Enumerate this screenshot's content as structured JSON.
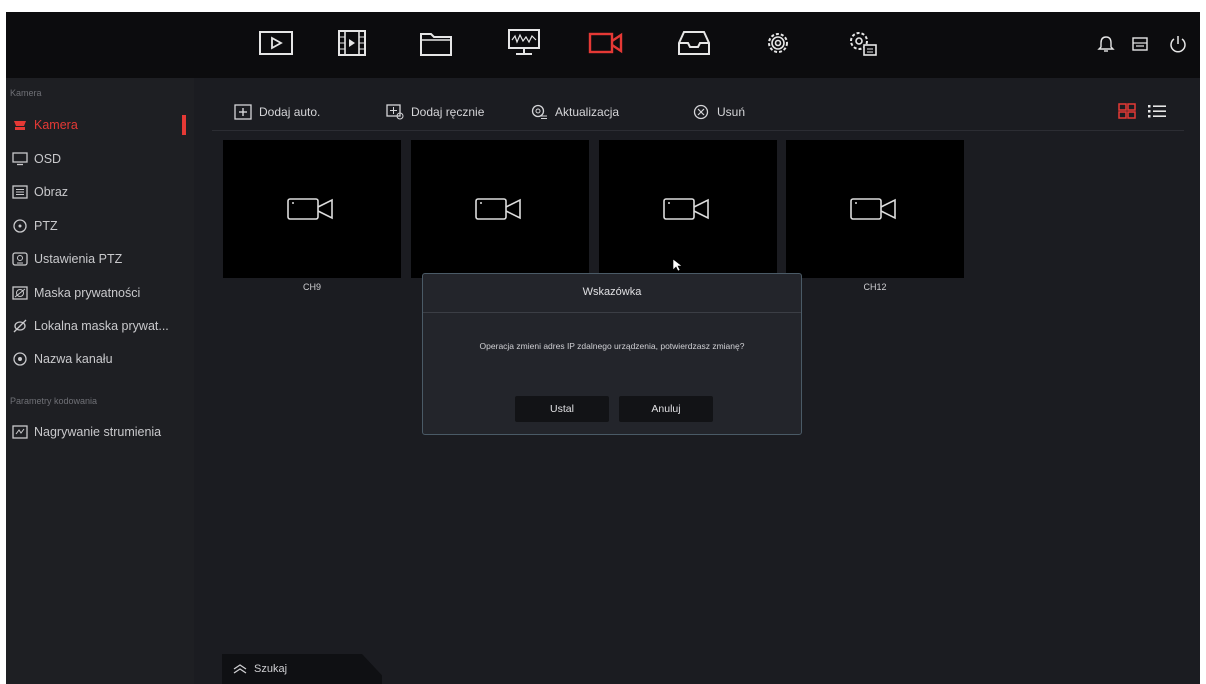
{
  "top_nav": {
    "icons": [
      "playback-icon",
      "video-clip-icon",
      "folder-icon",
      "monitor-waveform-icon",
      "camera-icon",
      "storage-icon",
      "settings-icon",
      "system-settings-icon"
    ],
    "active": "camera-icon",
    "right_icons": [
      "bell-icon",
      "drive-icon",
      "power-icon"
    ]
  },
  "sidebar": {
    "section1_title": "Kamera",
    "items": [
      {
        "label": "Kamera",
        "icon": "camera-icon",
        "active": true
      },
      {
        "label": "OSD",
        "icon": "osd-monitor-icon"
      },
      {
        "label": "Obraz",
        "icon": "image-settings-icon"
      },
      {
        "label": "PTZ",
        "icon": "ptz-icon"
      },
      {
        "label": "Ustawienia PTZ",
        "icon": "ptz-settings-icon"
      },
      {
        "label": "Maska prywatności",
        "icon": "privacy-mask-icon"
      },
      {
        "label": "Lokalna maska prywat...",
        "icon": "local-mask-icon"
      },
      {
        "label": "Nazwa kanału",
        "icon": "channel-name-icon"
      }
    ],
    "section2_title": "Parametry kodowania",
    "items2": [
      {
        "label": "Nagrywanie strumienia",
        "icon": "stream-record-icon"
      }
    ]
  },
  "toolbar": {
    "add_auto": "Dodaj auto.",
    "add_manual": "Dodaj ręcznie",
    "update": "Aktualizacja",
    "delete": "Usuń"
  },
  "channels": [
    "CH9",
    "",
    "",
    "CH12"
  ],
  "search": {
    "label": "Szukaj"
  },
  "dialog": {
    "title": "Wskazówka",
    "message": "Operacja zmieni adres IP zdalnego urządzenia, potwierdzasz zmianę?",
    "confirm": "Ustal",
    "cancel": "Anuluj"
  },
  "colors": {
    "accent": "#e53935",
    "background": "#1b1c21",
    "topbar": "#0c0c0e"
  }
}
